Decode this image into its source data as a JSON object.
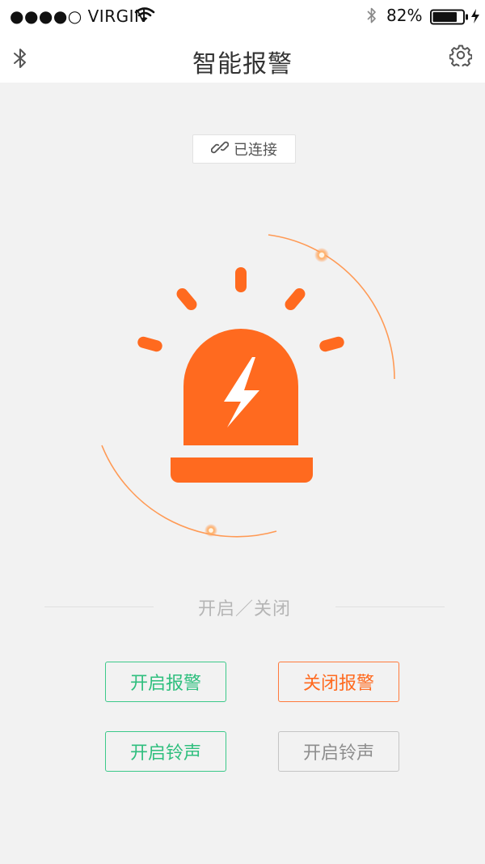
{
  "status_bar": {
    "carrier": "●●●●○ VIRGIN",
    "battery_percent": "82%",
    "battery_level": 0.82,
    "icons": [
      "wifi-icon",
      "bluetooth-icon",
      "battery-icon",
      "charging-icon"
    ]
  },
  "nav": {
    "title": "智能报警",
    "left_icon": "bluetooth-icon",
    "right_icon": "gear-icon"
  },
  "connection": {
    "status_label": "已连接",
    "icon": "link-icon"
  },
  "alarm": {
    "icon": "alarm-siren-icon",
    "color": "#ff6a1f"
  },
  "section": {
    "label": "开启／关闭"
  },
  "buttons": {
    "enable_alarm": "开启报警",
    "disable_alarm": "关闭报警",
    "enable_ringtone": "开启铃声",
    "enable_ringtone_disabled": "开启铃声"
  },
  "colors": {
    "accent_orange": "#ff6a1f",
    "accent_green": "#3cc98a",
    "disabled_gray": "#c5c5c5",
    "background": "#f2f2f2"
  }
}
